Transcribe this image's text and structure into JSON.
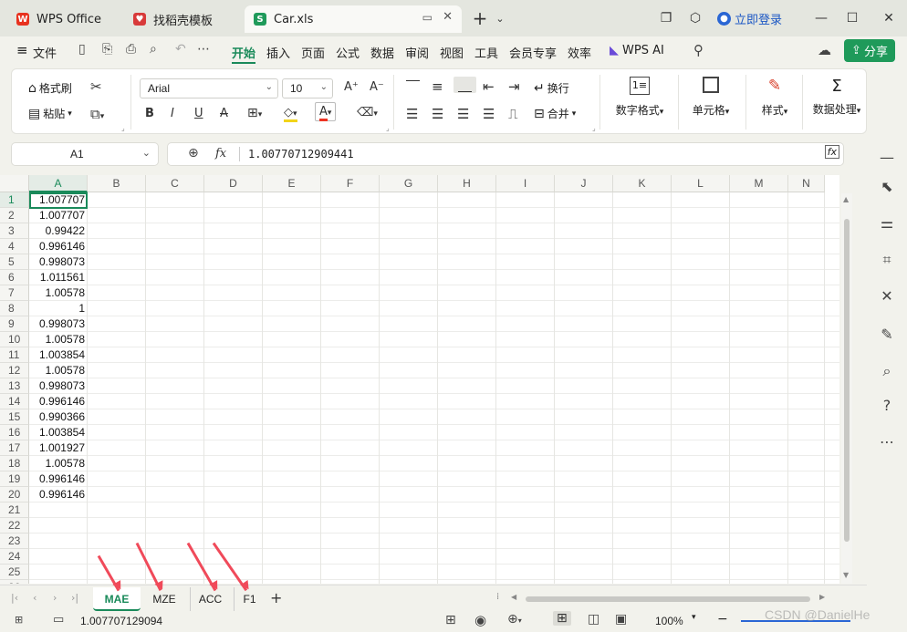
{
  "tabs": [
    {
      "label": "WPS Office"
    },
    {
      "label": "找稻壳模板"
    },
    {
      "label": "Car.xls"
    }
  ],
  "header": {
    "login": "立即登录"
  },
  "menu": {
    "file": "文件",
    "items": [
      "开始",
      "插入",
      "页面",
      "公式",
      "数据",
      "审阅",
      "视图",
      "工具",
      "会员专享",
      "效率"
    ],
    "wpsai": "WPS AI",
    "share": "分享"
  },
  "ribbon": {
    "format_painter": "格式刷",
    "paste": "粘贴",
    "font": "Arial",
    "size": "10",
    "wrap": "换行",
    "merge": "合并",
    "numfmt": "数字格式",
    "cell": "单元格",
    "style": "样式",
    "dataproc": "数据处理"
  },
  "formula": {
    "namebox": "A1",
    "fx": "fx",
    "value": "1.00770712909441"
  },
  "columns": [
    "A",
    "B",
    "C",
    "D",
    "E",
    "F",
    "G",
    "H",
    "I",
    "J",
    "K",
    "L",
    "M",
    "N"
  ],
  "rows": [
    "1",
    "2",
    "3",
    "4",
    "5",
    "6",
    "7",
    "8",
    "9",
    "10",
    "11",
    "12",
    "13",
    "14",
    "15",
    "16",
    "17",
    "18",
    "19",
    "20",
    "21",
    "22",
    "23",
    "24",
    "25",
    "26"
  ],
  "cells": [
    "1.007707",
    "1.007707",
    "0.99422",
    "0.996146",
    "0.998073",
    "1.011561",
    "1.00578",
    "1",
    "0.998073",
    "1.00578",
    "1.003854",
    "1.00578",
    "0.998073",
    "0.996146",
    "0.990366",
    "1.003854",
    "1.001927",
    "1.00578",
    "0.996146",
    "0.996146"
  ],
  "sheets": [
    "MAE",
    "MZE",
    "ACC",
    "F1"
  ],
  "status": {
    "value": "1.007707129094",
    "zoom": "100%"
  },
  "watermark": "CSDN @DanielHe",
  "colors": {
    "accent": "#1a8a5a",
    "arrow": "#f04a5a"
  }
}
